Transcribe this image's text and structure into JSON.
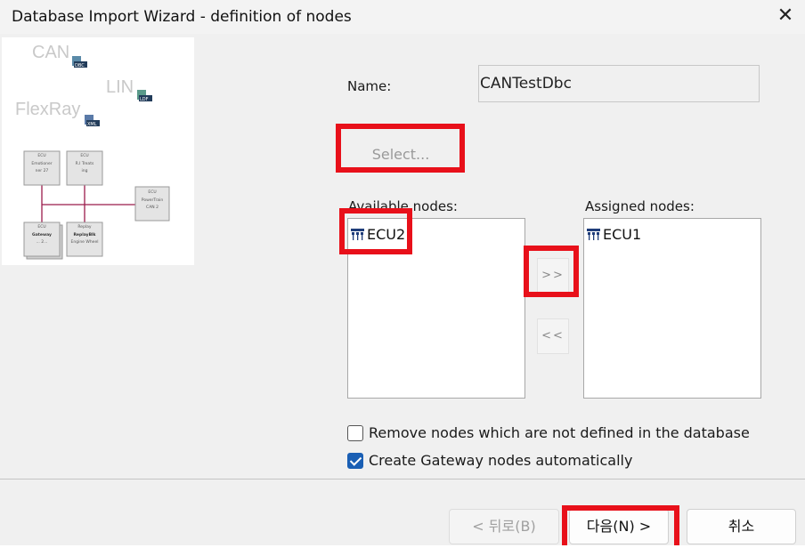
{
  "window": {
    "title": "Database Import Wizard - definition of nodes",
    "close_icon": "close-icon"
  },
  "illustration": {
    "bus_labels": {
      "can": "CAN",
      "lin": "LIN",
      "flexray": "FlexRay"
    },
    "file_badges": {
      "dbc": "DBC",
      "ldf": "LDF",
      "xml": "XML"
    },
    "ecu_boxes": [
      {
        "line1": "ECU",
        "line2": "Emotioner",
        "line3": "ner 27"
      },
      {
        "line1": "ECU",
        "line2": "R.I Treats",
        "line3": "ing"
      },
      {
        "line1": "ECU",
        "line2": "PowerTrain",
        "line3": "CAN 2"
      },
      {
        "line1": "ECU",
        "line2": "Gateway",
        "line3": "... 2..."
      },
      {
        "line1": "Replay",
        "line2": "ReplayBlk",
        "line3": "Engine Wheel"
      }
    ],
    "colors": {
      "bus_line": "#9b1b4a"
    }
  },
  "form": {
    "name_label": "Name:",
    "name_value": "CANTestDbc",
    "select_label": "Select..."
  },
  "available": {
    "label": "Available nodes:",
    "items": [
      {
        "label": "ECU2",
        "icon": "network-node-icon"
      }
    ]
  },
  "assigned": {
    "label": "Assigned nodes:",
    "items": [
      {
        "label": "ECU1",
        "icon": "network-node-icon"
      }
    ]
  },
  "move_buttons": {
    "assign": ">>",
    "unassign": "<<"
  },
  "options": {
    "remove_nodes": {
      "label": "Remove nodes which are not defined in the database",
      "checked": false
    },
    "create_gateway": {
      "label": "Create Gateway nodes automatically",
      "checked": true
    }
  },
  "footer": {
    "back": "< 뒤로(B)",
    "next": "다음(N) >",
    "cancel": "취소"
  },
  "colors": {
    "highlight": "#e8101a",
    "checkbox_accent": "#1a5fb4"
  }
}
